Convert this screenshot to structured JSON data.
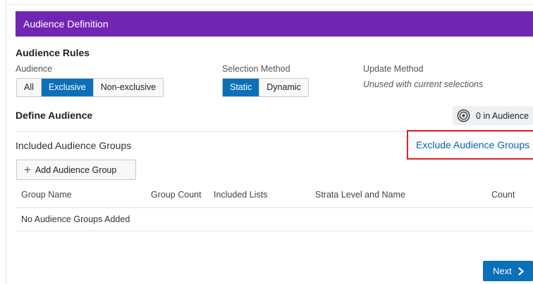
{
  "panel": {
    "title": "Audience Definition"
  },
  "audience_rules": {
    "title": "Audience Rules",
    "audience": {
      "label": "Audience",
      "options": [
        "All",
        "Exclusive",
        "Non-exclusive"
      ],
      "selected": "Exclusive"
    },
    "selection_method": {
      "label": "Selection Method",
      "options": [
        "Static",
        "Dynamic"
      ],
      "selected": "Static"
    },
    "update_method": {
      "label": "Update Method",
      "note": "Unused with current selections"
    }
  },
  "define_audience": {
    "title": "Define Audience",
    "count_badge": "0 in Audience",
    "badge_icon": "target-icon"
  },
  "groups": {
    "included_label": "Included Audience Groups",
    "exclude_link": "Exclude Audience Groups",
    "add_button": "Add Audience Group",
    "add_icon": "plus-icon",
    "columns": [
      "Group Name",
      "Group Count",
      "Included Lists",
      "Strata Level and Name",
      "Count"
    ],
    "empty_message": "No Audience Groups Added"
  },
  "footer": {
    "next_label": "Next",
    "next_icon": "chevron-right-icon"
  },
  "colors": {
    "header": "#7125b3",
    "primary": "#0a70b8",
    "link": "#0a62a8",
    "highlight": "#e21e26"
  }
}
